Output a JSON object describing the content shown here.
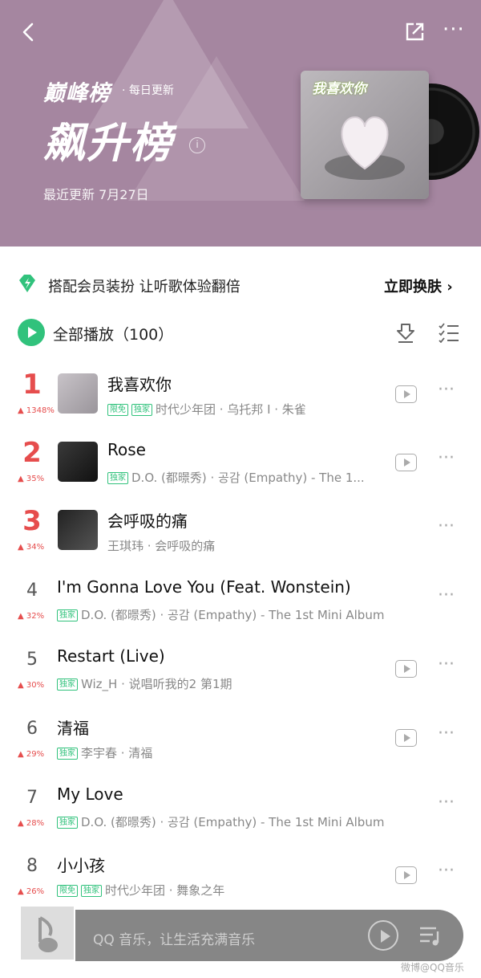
{
  "header": {
    "brand": "巅峰榜",
    "daily": "· 每日更新",
    "title": "飙升榜",
    "updated": "最近更新 7月27日",
    "cover_text": "我喜欢你",
    "background": "#a586a0",
    "icons": [
      "back-arrow-icon",
      "share-icon",
      "more-icon",
      "info-icon"
    ]
  },
  "promo": {
    "text": "搭配会员装扮  让听歌体验翻倍",
    "link": "立即换肤 ›",
    "icon": "green-gem-icon"
  },
  "list_header": {
    "play_all": "全部播放（100）",
    "accent": "#31c27c",
    "icons": [
      "play-circle-icon",
      "download-icon",
      "multi-select-icon"
    ]
  },
  "songs": [
    {
      "rank": "1",
      "trend": "▲ 1348%",
      "title": "我喜欢你",
      "tags": [
        "限免",
        "独家"
      ],
      "meta": "时代少年团 · 乌托邦 I · 朱雀",
      "has_mv": true
    },
    {
      "rank": "2",
      "trend": "▲ 35%",
      "title": "Rose",
      "tags": [
        "独家"
      ],
      "meta": "D.O. (都暻秀) · 공감 (Empathy) - The 1...",
      "has_mv": true
    },
    {
      "rank": "3",
      "trend": "▲ 34%",
      "title": "会呼吸的痛",
      "tags": [],
      "meta": "王琪玮 · 会呼吸的痛",
      "has_mv": false
    },
    {
      "rank": "4",
      "trend": "▲ 32%",
      "title": "I'm Gonna Love You (Feat. Wonstein)",
      "tags": [
        "独家"
      ],
      "meta": "D.O. (都暻秀) · 공감 (Empathy) - The 1st Mini Album",
      "has_mv": false
    },
    {
      "rank": "5",
      "trend": "▲ 30%",
      "title": "Restart (Live)",
      "tags": [
        "独家"
      ],
      "meta": "Wiz_H · 说唱听我的2 第1期",
      "has_mv": true
    },
    {
      "rank": "6",
      "trend": "▲ 29%",
      "title": "清福",
      "tags": [
        "独家"
      ],
      "meta": "李宇春 · 清福",
      "has_mv": true
    },
    {
      "rank": "7",
      "trend": "▲ 28%",
      "title": "My Love",
      "tags": [
        "独家"
      ],
      "meta": "D.O. (都暻秀) · 공감 (Empathy) - The 1st Mini Album",
      "has_mv": false
    },
    {
      "rank": "8",
      "trend": "▲ 26%",
      "title": "小小孩",
      "tags": [
        "限免",
        "独家"
      ],
      "meta": "时代少年团 · 舞象之年",
      "has_mv": true
    }
  ],
  "player": {
    "text": "QQ 音乐，让生活充满音乐",
    "icons": [
      "music-note-icon",
      "play-icon",
      "playlist-icon"
    ]
  },
  "watermark": "微博@QQ音乐"
}
